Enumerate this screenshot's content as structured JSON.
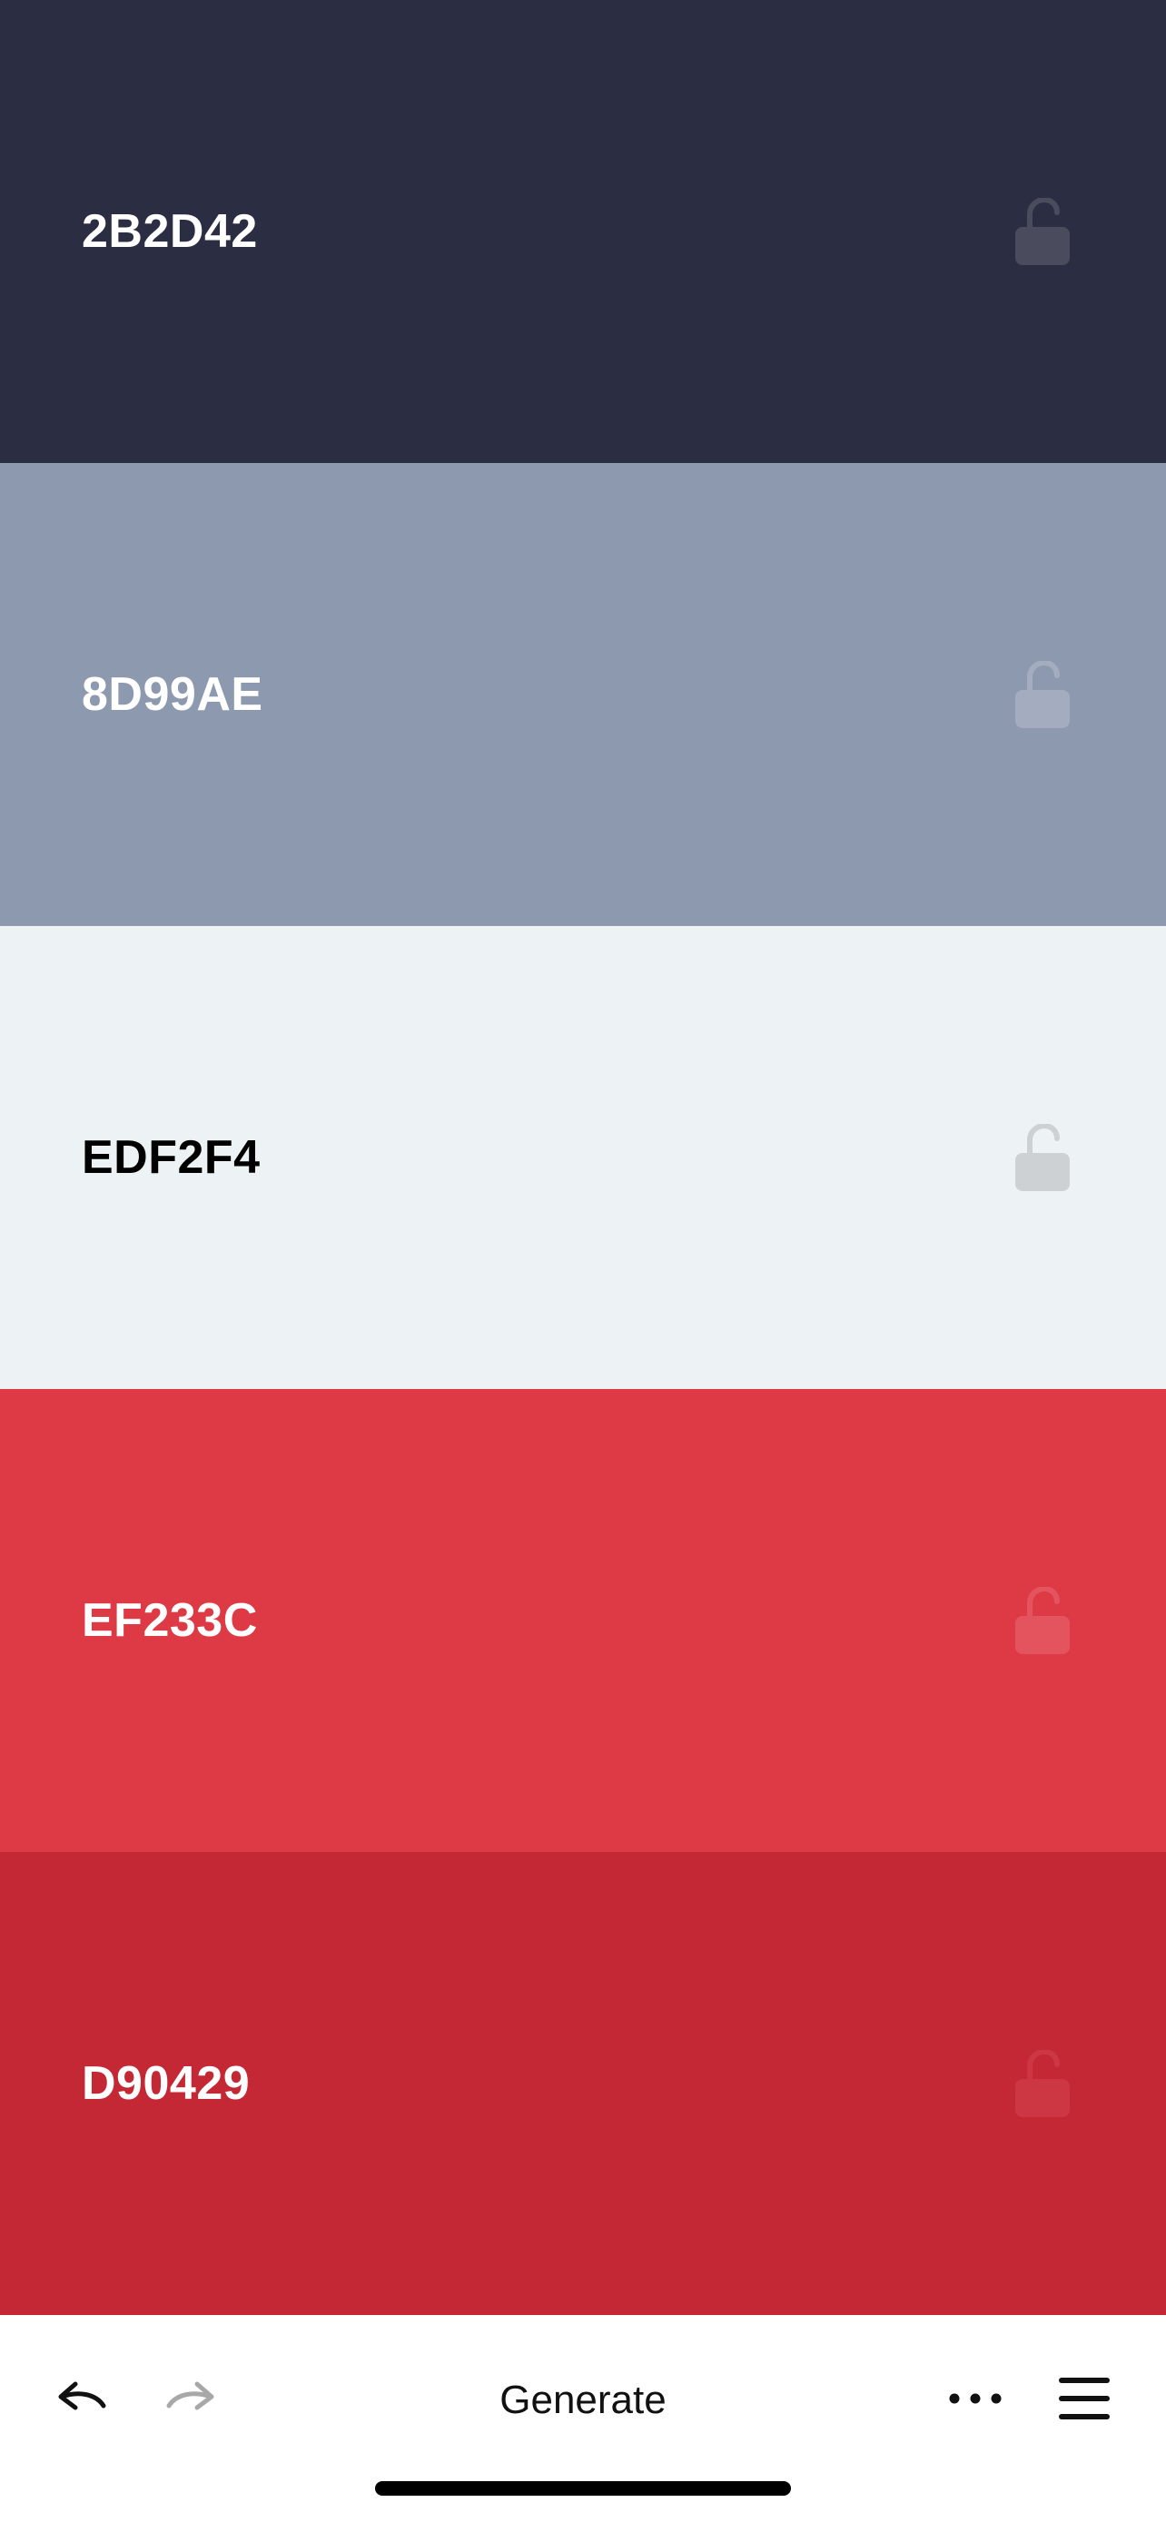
{
  "palette": {
    "swatches": [
      {
        "hex": "2B2D42",
        "color": "#2B2D42",
        "text_color": "#FFFFFF",
        "lock_color": "#4A4C5E",
        "lock_state": "unlocked"
      },
      {
        "hex": "8D99AE",
        "color": "#8D99AE",
        "text_color": "#FFFFFF",
        "lock_color": "#A3ADBF",
        "lock_state": "unlocked"
      },
      {
        "hex": "EDF2F4",
        "color": "#EDF2F4",
        "text_color": "#000000",
        "lock_color": "#CDD1D4",
        "lock_state": "unlocked"
      },
      {
        "hex": "EF233C",
        "color": "#DD3A46",
        "text_color": "#FFFFFF",
        "lock_color": "#E4545E",
        "lock_state": "unlocked"
      },
      {
        "hex": "D90429",
        "color": "#C42834",
        "text_color": "#FFFFFF",
        "lock_color": "#CC3743",
        "lock_state": "unlocked"
      }
    ]
  },
  "toolbar": {
    "undo_icon": "undo-arrow-icon",
    "redo_icon": "redo-arrow-icon",
    "generate_label": "Generate",
    "more_icon": "more-horizontal-icon",
    "menu_icon": "hamburger-menu-icon",
    "undo_enabled": true,
    "redo_enabled": false,
    "icon_color": "#111111",
    "disabled_icon_color": "#A8A8A8"
  }
}
